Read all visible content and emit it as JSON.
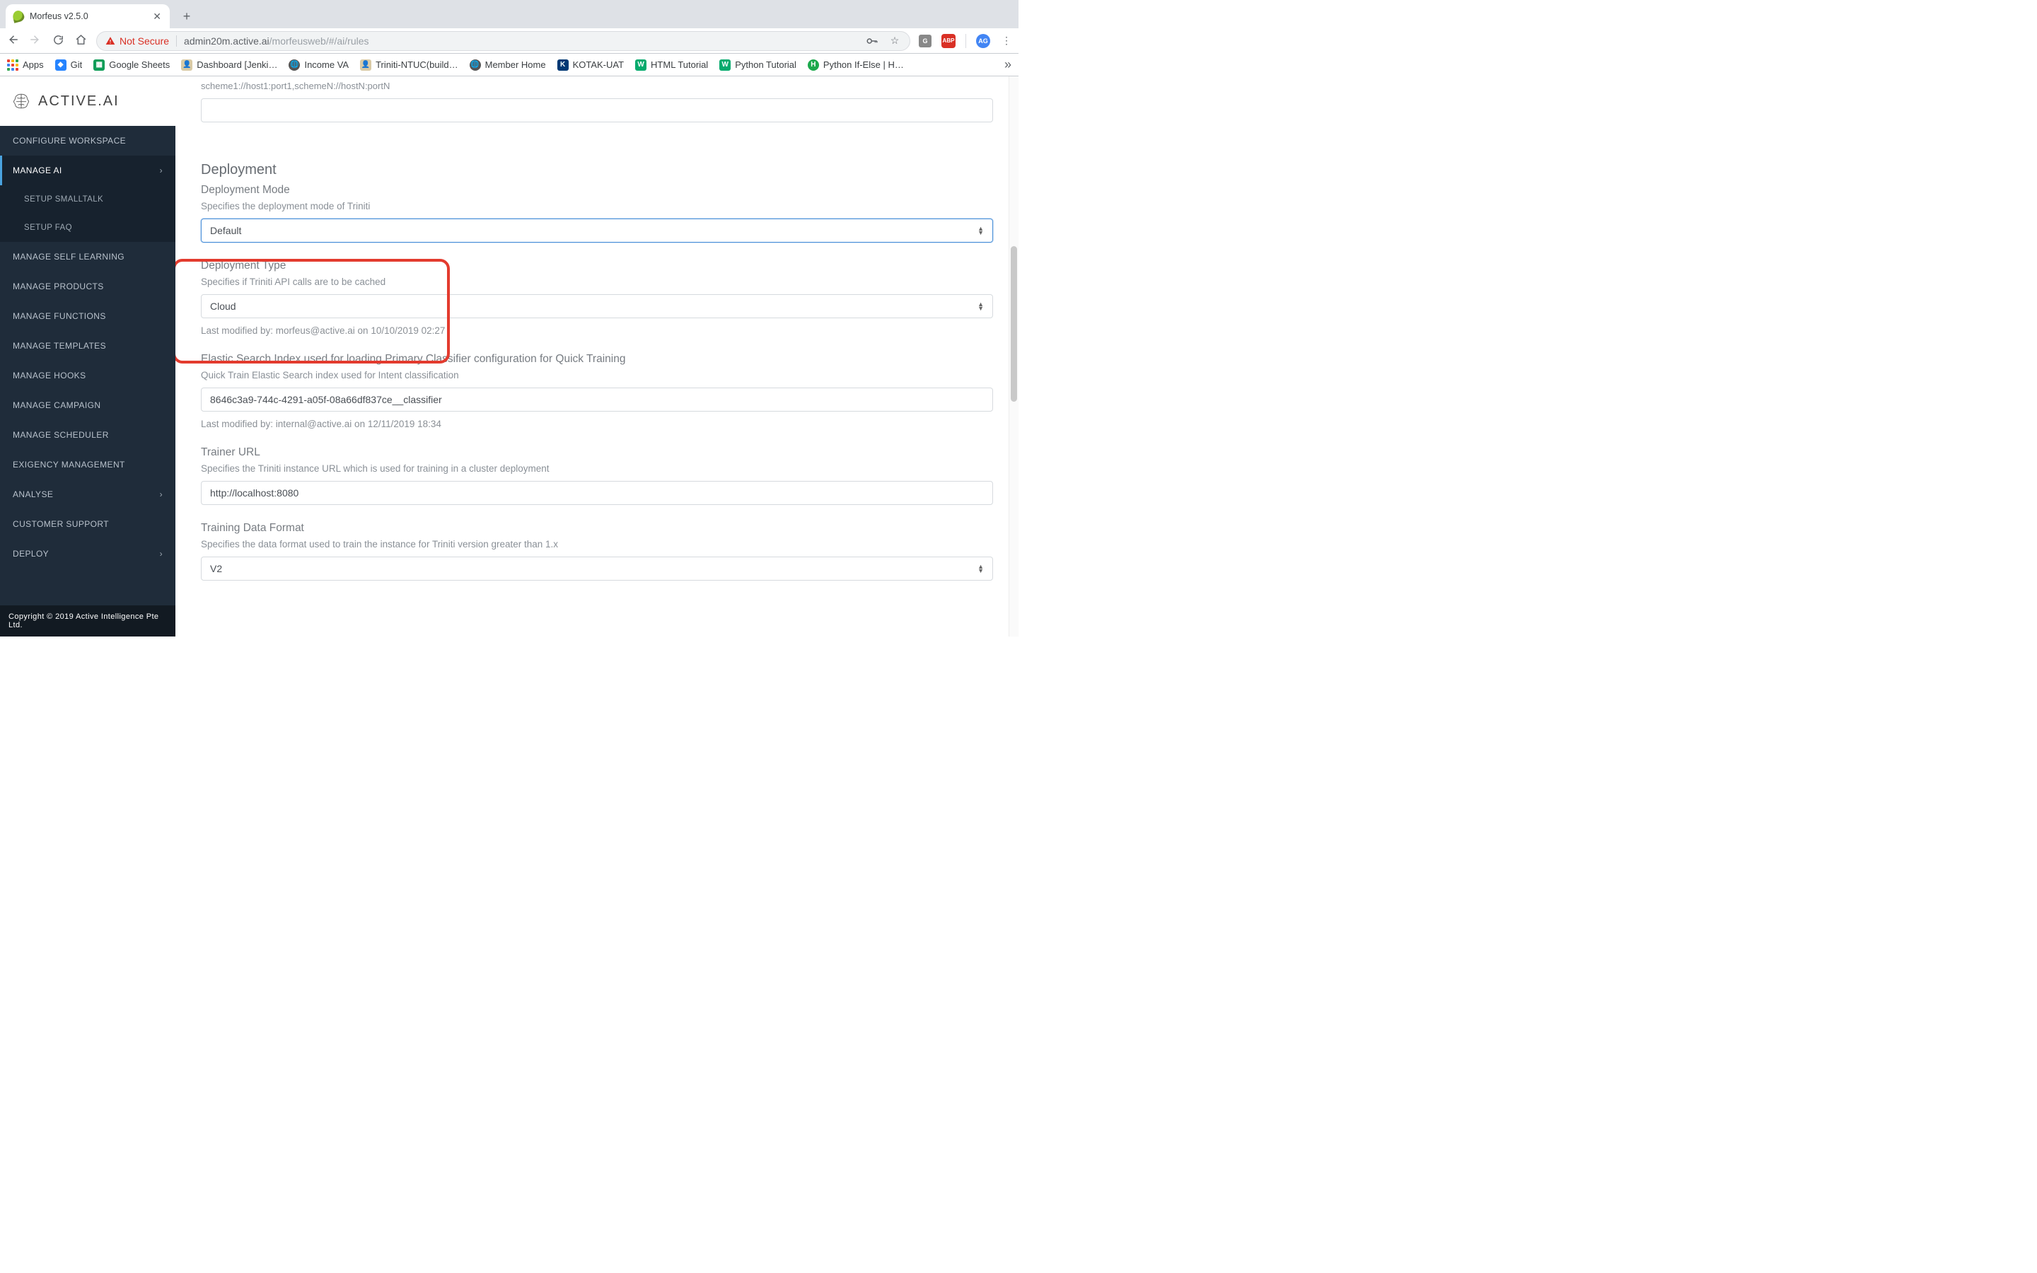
{
  "chrome": {
    "tab_title": "Morfeus v2.5.0",
    "not_secure_label": "Not Secure",
    "url_host": "admin20m.active.ai",
    "url_path": "/morfeusweb/#/ai/rules",
    "avatar_initials": "AG",
    "ext_g": "G",
    "ext_abp": "ABP"
  },
  "bookmarks": {
    "apps": "Apps",
    "items": [
      "Git",
      "Google Sheets",
      "Dashboard [Jenki…",
      "Income VA",
      "Triniti-NTUC(build…",
      "Member Home",
      "KOTAK-UAT",
      "HTML Tutorial",
      "Python Tutorial",
      "Python If-Else | H…"
    ]
  },
  "brand": {
    "name": "ACTIVE.AI"
  },
  "sidebar": {
    "configure": "Configure Workspace",
    "manage_ai": "Manage AI",
    "setup_smalltalk": "Setup Smalltalk",
    "setup_faq": "Setup FAQ",
    "self_learning": "Manage Self Learning",
    "products": "Manage Products",
    "functions": "Manage Functions",
    "templates": "Manage Templates",
    "hooks": "Manage Hooks",
    "campaign": "Manage Campaign",
    "scheduler": "Manage Scheduler",
    "exigency": "Exigency Management",
    "analyse": "Analyse",
    "support": "Customer Support",
    "deploy": "Deploy"
  },
  "footer": "Copyright © 2019 Active Intelligence Pte Ltd.",
  "content": {
    "preamble_hint": "scheme1://host1:port1,schemeN://hostN:portN",
    "section_deployment": "Deployment",
    "mode_label": "Deployment Mode",
    "mode_desc": "Specifies the deployment mode of Triniti",
    "mode_value": "Default",
    "type_label": "Deployment Type",
    "type_desc": "Specifies if Triniti API calls are to be cached",
    "type_value": "Cloud",
    "type_mod": "Last modified by: morfeus@active.ai on 10/10/2019 02:27",
    "es_label": "Elastic Search Index used for loading Primary Classifier configuration for Quick Training",
    "es_desc": "Quick Train Elastic Search index used for Intent classification",
    "es_value": "8646c3a9-744c-4291-a05f-08a66df837ce__classifier",
    "es_mod": "Last modified by: internal@active.ai on 12/11/2019 18:34",
    "trainer_label": "Trainer URL",
    "trainer_desc": "Specifies the Triniti instance URL which is used for training in a cluster deployment",
    "trainer_value": "http://localhost:8080",
    "format_label": "Training Data Format",
    "format_desc": "Specifies the data format used to train the instance for Triniti version greater than 1.x",
    "format_value": "V2"
  }
}
